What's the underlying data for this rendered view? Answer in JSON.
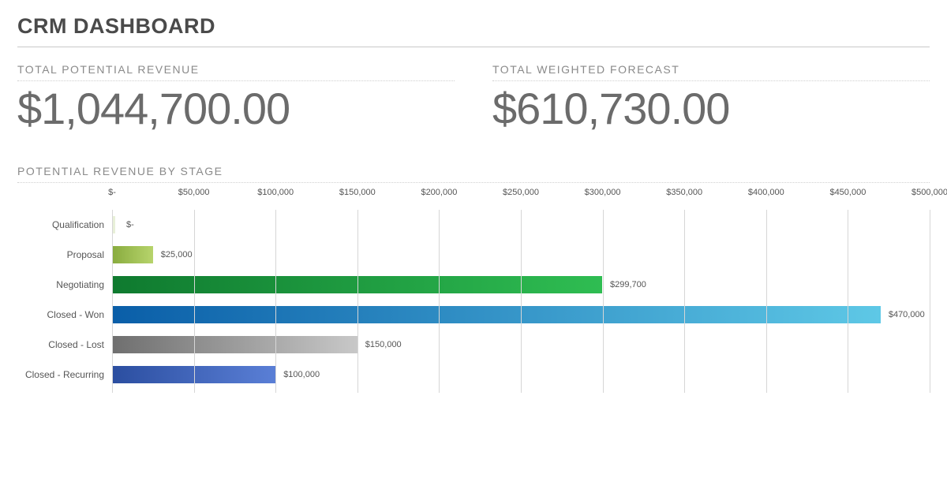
{
  "title": "CRM DASHBOARD",
  "kpis": [
    {
      "label": "TOTAL POTENTIAL REVENUE",
      "value": "$1,044,700.00"
    },
    {
      "label": "TOTAL WEIGHTED FORECAST",
      "value": "$610,730.00"
    }
  ],
  "chart_section_label": "POTENTIAL REVENUE BY STAGE",
  "chart_data": {
    "type": "bar",
    "orientation": "horizontal",
    "title": "POTENTIAL REVENUE BY STAGE",
    "xlabel": "",
    "ylabel": "",
    "xlim": [
      0,
      500000
    ],
    "tick_values": [
      0,
      50000,
      100000,
      150000,
      200000,
      250000,
      300000,
      350000,
      400000,
      450000,
      500000
    ],
    "tick_labels": [
      "$-",
      "$50,000",
      "$100,000",
      "$150,000",
      "$200,000",
      "$250,000",
      "$300,000",
      "$350,000",
      "$400,000",
      "$450,000",
      "$500,000"
    ],
    "categories": [
      "Qualification",
      "Proposal",
      "Negotiating",
      "Closed - Won",
      "Closed - Lost",
      "Closed - Recurring"
    ],
    "values": [
      0,
      25000,
      299700,
      470000,
      150000,
      100000
    ],
    "value_labels": [
      "$-",
      "$25,000",
      "$299,700",
      "$470,000",
      "$150,000",
      "$100,000"
    ],
    "bar_gradients": [
      [
        "#e8f0d8",
        "#e8f0d8"
      ],
      [
        "#88ab3e",
        "#b7d46c"
      ],
      [
        "#0f7a2f",
        "#2fbd52"
      ],
      [
        "#0a5ea8",
        "#5ec8e6"
      ],
      [
        "#6f6f6f",
        "#c8c8c8"
      ],
      [
        "#2b4ea0",
        "#5a7fd6"
      ]
    ]
  }
}
